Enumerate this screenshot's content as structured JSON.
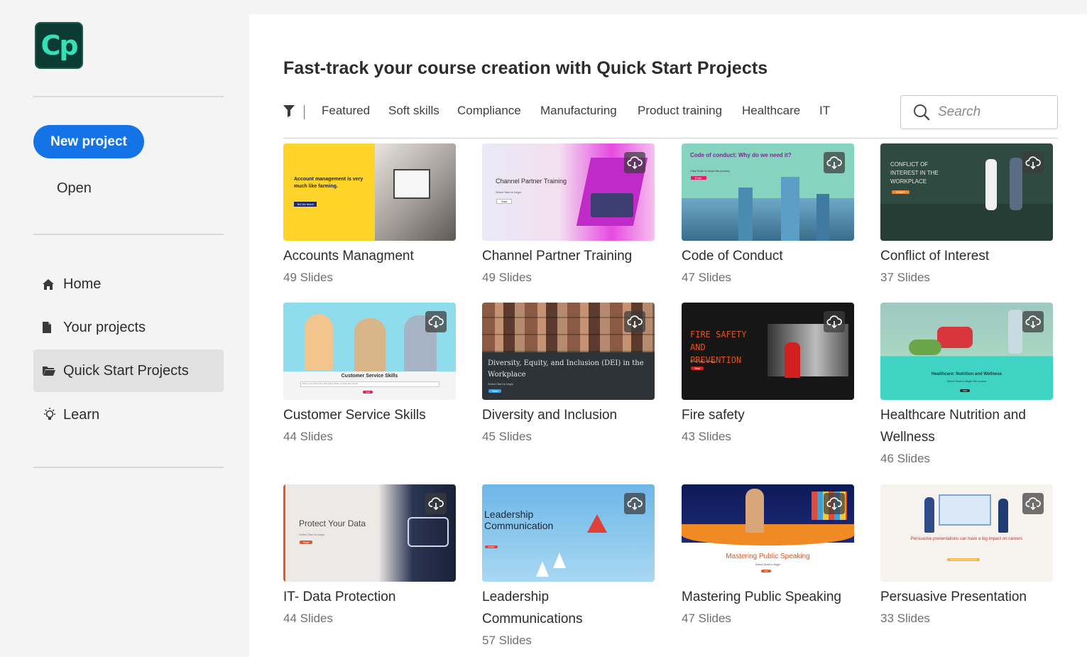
{
  "app": {
    "logo_text": "Cp",
    "brand_color": "#35e0b6",
    "accent": "#1473e6"
  },
  "sidebar": {
    "new_project_label": "New project",
    "open_label": "Open",
    "nav": [
      {
        "label": "Home",
        "icon": "home-icon"
      },
      {
        "label": "Your projects",
        "icon": "file-icon"
      },
      {
        "label": "Quick Start Projects",
        "icon": "folder-open-icon",
        "active": true
      },
      {
        "label": "Learn",
        "icon": "lightbulb-icon"
      }
    ]
  },
  "main": {
    "title": "Fast-track your course creation with Quick Start Projects",
    "categories": [
      "Featured",
      "Soft skills",
      "Compliance",
      "Manufacturing",
      "Product training",
      "Healthcare",
      "IT"
    ],
    "search": {
      "placeholder": "Search",
      "value": ""
    },
    "projects": [
      {
        "title": "Accounts Managment",
        "slides": "49 Slides",
        "thumb_text": "Account management is very much like farming.",
        "thumb_button": "Tell Me More!"
      },
      {
        "title": "Channel Partner Training",
        "slides": "49 Slides",
        "thumb_text": "Channel Partner Training",
        "thumb_sub": "Select Start to begin",
        "thumb_button": "Start"
      },
      {
        "title": "Code of Conduct",
        "slides": "47 Slides",
        "thumb_text": "Code of conduct: Why do we need it?",
        "thumb_sub": "Click Enter to begin the journey",
        "thumb_button": "Enter"
      },
      {
        "title": "Conflict of Interest",
        "slides": "37 Slides",
        "thumb_text": "CONFLICT OF INTEREST IN THE WORKPLACE",
        "thumb_button": "START"
      },
      {
        "title": "Customer Service Skills",
        "slides": "44 Slides",
        "thumb_text": "Customer Service Skills",
        "thumb_sub": "Enter your name here and select 'Start' to begin the course",
        "thumb_button": "Start"
      },
      {
        "title": "Diversity and Inclusion",
        "slides": "45 Slides",
        "thumb_text": "Diversity, Equity, and Inclusion (DEI) in the Workplace",
        "thumb_sub": "Select Start to begin",
        "thumb_button": "Start"
      },
      {
        "title": "Fire safety",
        "slides": "43 Slides",
        "thumb_text": "FIRE SAFETY AND PREVENTION",
        "thumb_sub": "Select Start to begin",
        "thumb_button": "Start"
      },
      {
        "title": "Healthcare Nutrition and Wellness",
        "slides": "46 Slides",
        "thumb_text": "Healthcare: Nutrition and Wellness",
        "thumb_sub": "Select Start to begin the course",
        "thumb_button": "Start"
      },
      {
        "title": "IT- Data Protection",
        "slides": "44 Slides",
        "thumb_text": "Protect Your Data",
        "thumb_sub": "Select Start to begin",
        "thumb_button": "Start"
      },
      {
        "title": "Leadership Communications",
        "slides": "57 Slides",
        "thumb_text": "Leadership Communication",
        "thumb_button": "START"
      },
      {
        "title": "Mastering Public Speaking",
        "slides": "47 Slides",
        "thumb_text": "Mastering Public Speaking",
        "thumb_sub": "Select Start to begin",
        "thumb_button": "Start"
      },
      {
        "title": "Persuasive Presentation",
        "slides": "33 Slides",
        "thumb_text": "Persuasive presentations can have a big impact on careers",
        "thumb_button": "LETS START WITH BASICS"
      }
    ]
  }
}
